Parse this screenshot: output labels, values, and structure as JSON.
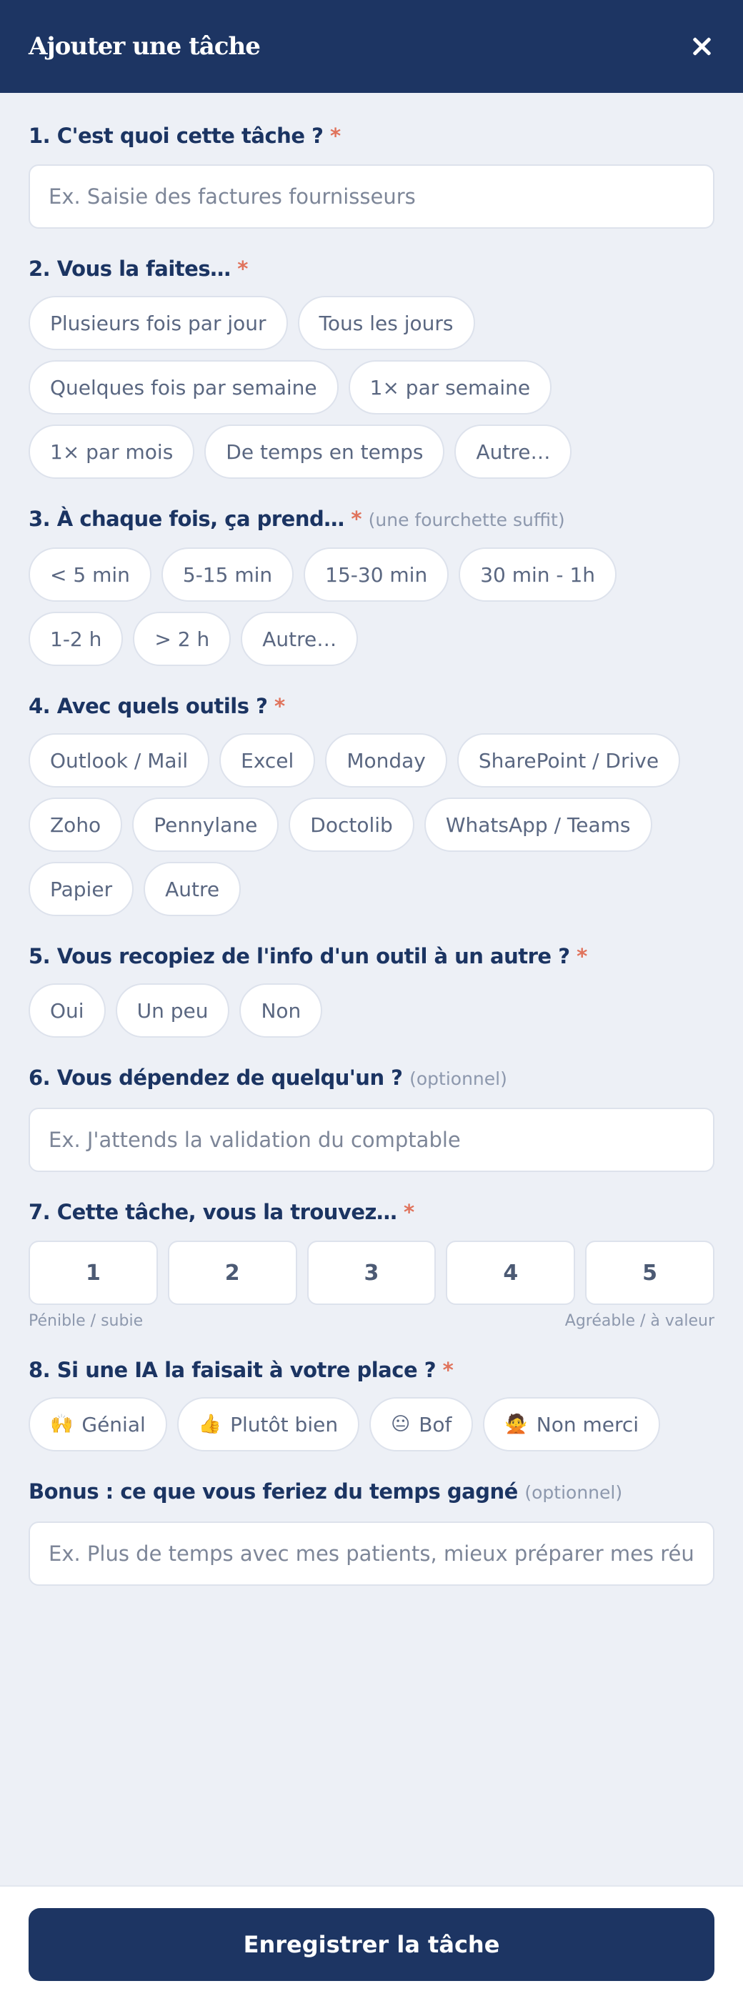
{
  "header": {
    "title": "Ajouter une tâche"
  },
  "q1": {
    "label": "1. C'est quoi cette tâche ?",
    "required": "*",
    "placeholder": "Ex. Saisie des factures fournisseurs",
    "value": ""
  },
  "q2": {
    "label": "2. Vous la faites…",
    "required": "*",
    "options": [
      "Plusieurs fois par jour",
      "Tous les jours",
      "Quelques fois par semaine",
      "1× par semaine",
      "1× par mois",
      "De temps en temps",
      "Autre…"
    ]
  },
  "q3": {
    "label": "3. À chaque fois, ça prend…",
    "required": "*",
    "hint": "(une fourchette suffit)",
    "options": [
      "< 5 min",
      "5-15 min",
      "15-30 min",
      "30 min - 1h",
      "1-2 h",
      "> 2 h",
      "Autre…"
    ]
  },
  "q4": {
    "label": "4. Avec quels outils ?",
    "required": "*",
    "options": [
      "Outlook / Mail",
      "Excel",
      "Monday",
      "SharePoint / Drive",
      "Zoho",
      "Pennylane",
      "Doctolib",
      "WhatsApp / Teams",
      "Papier",
      "Autre"
    ]
  },
  "q5": {
    "label": "5. Vous recopiez de l'info d'un outil à un autre ?",
    "required": "*",
    "options": [
      "Oui",
      "Un peu",
      "Non"
    ]
  },
  "q6": {
    "label": "6. Vous dépendez de quelqu'un ?",
    "hint": "(optionnel)",
    "placeholder": "Ex. J'attends la validation du comptable",
    "value": ""
  },
  "q7": {
    "label": "7. Cette tâche, vous la trouvez…",
    "required": "*",
    "options": [
      "1",
      "2",
      "3",
      "4",
      "5"
    ],
    "low_label": "Pénible / subie",
    "high_label": "Agréable / à valeur"
  },
  "q8": {
    "label": "8. Si une IA la faisait à votre place ?",
    "required": "*",
    "options": [
      {
        "emoji": "🙌",
        "icon": "raised-hands-icon",
        "label": "Génial"
      },
      {
        "emoji": "👍",
        "icon": "thumbs-up-icon",
        "label": "Plutôt bien"
      },
      {
        "emoji": "😐",
        "icon": "neutral-face-icon",
        "label": "Bof"
      },
      {
        "emoji": "🙅",
        "icon": "no-gesture-icon",
        "label": "Non merci"
      }
    ]
  },
  "bonus": {
    "label": "Bonus : ce que vous feriez du temps gagné",
    "hint": "(optionnel)",
    "placeholder": "Ex. Plus de temps avec mes patients, mieux préparer mes réunions",
    "value": ""
  },
  "footer": {
    "submit_label": "Enregistrer la tâche"
  },
  "colors": {
    "primary": "#1d3563",
    "required": "#e0735c",
    "background": "#edf0f6"
  }
}
